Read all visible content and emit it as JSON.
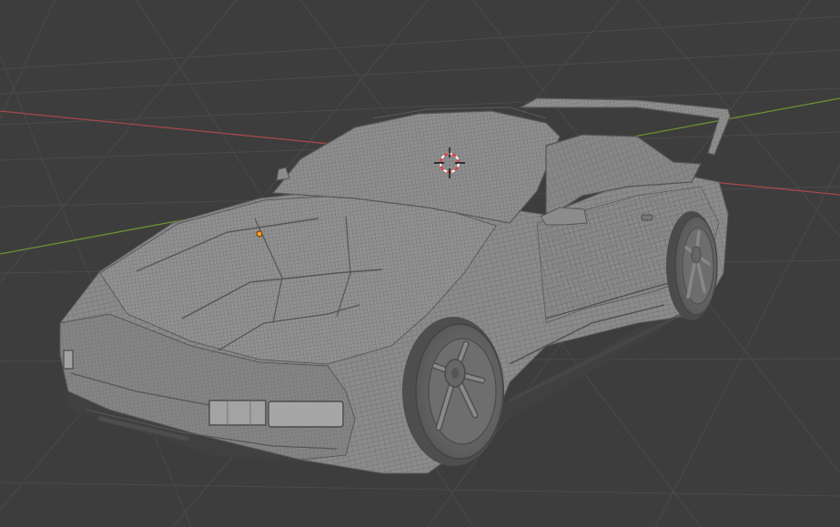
{
  "viewport": {
    "background_color": "#3d3d3d",
    "grid_color": "#4b4b4b",
    "x_axis_color": "#b24a4a",
    "y_axis_color": "#6f9a2f",
    "model_fill_color": "#8e8e8e",
    "model_wire_color": "#6a6a6a",
    "origin_color": "#ff9a2a",
    "cursor_color_a": "#ff3b3b",
    "cursor_color_b": "#ffffff",
    "object": "car-mesh",
    "display_mode": "wireframe-overlay",
    "view": "perspective"
  }
}
